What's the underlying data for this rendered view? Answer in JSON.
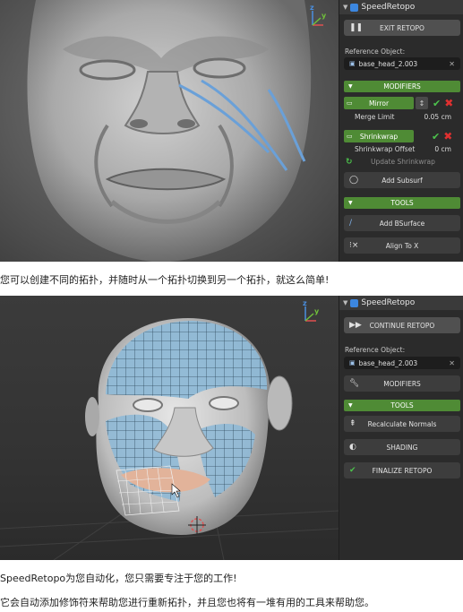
{
  "shot1": {
    "panel_title": "SpeedRetopo",
    "exit_label": "EXIT RETOPO",
    "reference_label": "Reference Object:",
    "reference_value": "base_head_2.003",
    "modifiers_section": "MODIFIERS",
    "mirror_label": "Mirror",
    "merge_limit_label": "Merge Limit",
    "merge_limit_value": "0.05 cm",
    "shrinkwrap_label": "Shrinkwrap",
    "shrinkwrap_offset_label": "Shrinkwrap Offset",
    "shrinkwrap_offset_value": "0 cm",
    "update_shrinkwrap_label": "Update Shrinkwrap",
    "add_subsurf_label": "Add Subsurf",
    "tools_section": "TOOLS",
    "add_bsurface_label": "Add BSurface",
    "align_to_x_label": "Align To X"
  },
  "caption1": "您可以创建不同的拓扑，并随时从一个拓扑切换到另一个拓扑，就这么简单!",
  "shot2": {
    "panel_title": "SpeedRetopo",
    "continue_label": "CONTINUE RETOPO",
    "reference_label": "Reference Object:",
    "reference_value": "base_head_2.003",
    "modifiers_label": "MODIFIERS",
    "tools_section": "TOOLS",
    "recalculate_label": "Recalculate Normals",
    "shading_label": "SHADING",
    "finalize_label": "FINALIZE RETOPO"
  },
  "caption2": "SpeedRetopo为您自动化，您只需要专注于您的工作!",
  "caption3": "它会自动添加修饰符来帮助您进行重新拓扑，并且您也将有一堆有用的工具来帮助您。",
  "colors": {
    "section_green": "#4f8b35",
    "check_green": "#4cc24c",
    "cross_red": "#e03030",
    "axis_x": "#e05050",
    "axis_y": "#6fbf3a",
    "axis_z": "#4a8fe0"
  },
  "icons": {
    "pause": "pause-icon",
    "play": "fast-forward-icon",
    "wrench": "wrench-icon",
    "normals": "recalculate-normals-icon",
    "shading": "shading-sphere-icon",
    "finalize": "checkmark-icon"
  }
}
